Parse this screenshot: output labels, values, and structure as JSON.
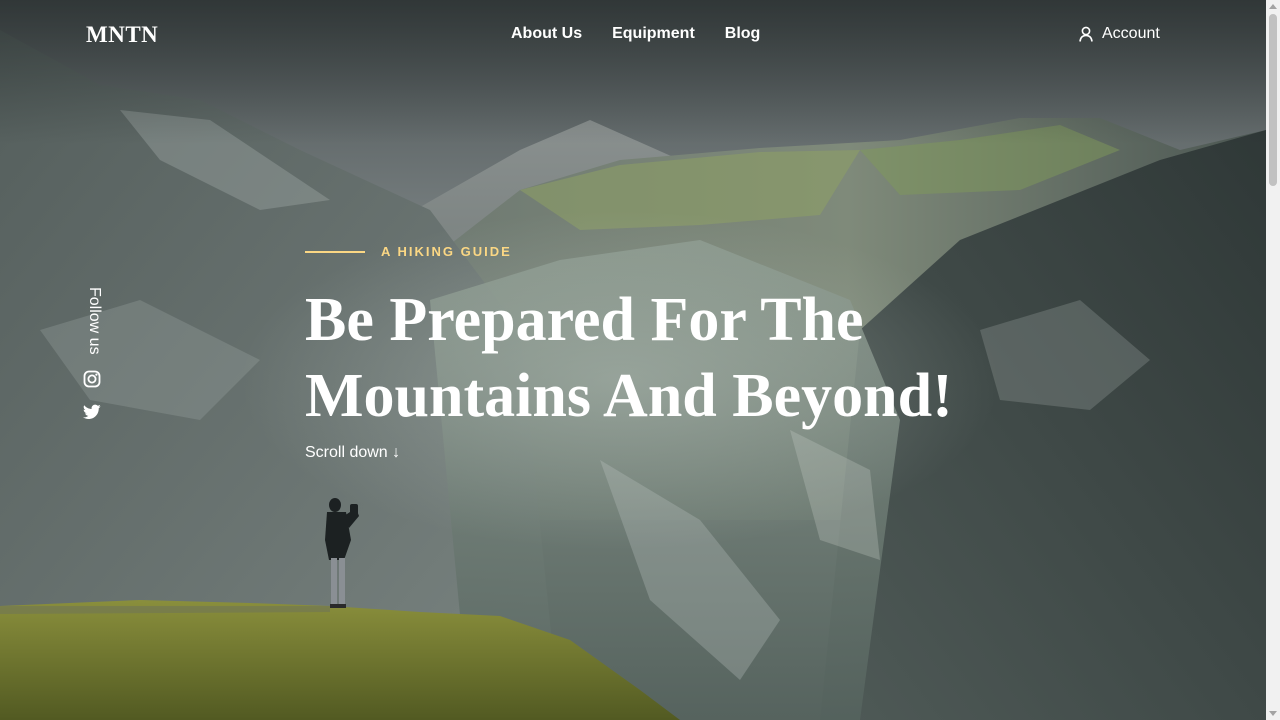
{
  "header": {
    "logo": "MNTN",
    "nav": [
      "About Us",
      "Equipment",
      "Blog"
    ],
    "account_label": "Account"
  },
  "sidebar": {
    "follow_label": "Follow us",
    "socials": [
      "instagram-icon",
      "twitter-icon"
    ]
  },
  "hero": {
    "tagline": "A HIKING GUIDE",
    "headline_line1": "Be Prepared For The",
    "headline_line2": "Mountains And Beyond!",
    "scroll_label": "Scroll down ↓"
  },
  "colors": {
    "accent": "#fbd784",
    "text": "#ffffff"
  }
}
